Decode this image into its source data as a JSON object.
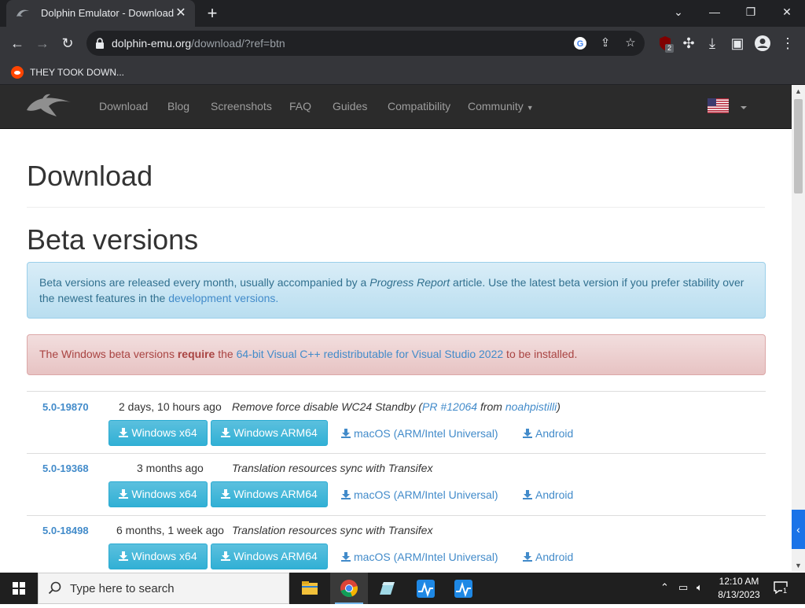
{
  "browser": {
    "tab_title": "Dolphin Emulator - Download",
    "url_host": "dolphin-emu.org",
    "url_path": "/download/?ref=btn",
    "extension_badge": "2",
    "bookmark_label": "THEY TOOK DOWN..."
  },
  "site_nav": {
    "links": [
      "Download",
      "Blog",
      "Screenshots",
      "FAQ",
      "Guides",
      "Compatibility",
      "Community"
    ]
  },
  "content": {
    "page_title": "Download",
    "section_title": "Beta versions",
    "info_text_1": "Beta versions are released every month, usually accompanied by a ",
    "info_text_em": "Progress Report",
    "info_text_2": " article. Use the latest beta version if you prefer stability over the newest features in the ",
    "info_link": "development versions.",
    "warning_text_1": "The Windows beta versions ",
    "warning_bold": "require",
    "warning_text_2": " the ",
    "warning_link": "64-bit Visual C++ redistributable for Visual Studio 2022",
    "warning_text_3": " to be installed."
  },
  "releases": [
    {
      "version": "5.0-19870",
      "age": "2 days, 10 hours ago",
      "desc_text": "Remove force disable WC24 Standby (",
      "pr_link": "PR #12064",
      "from": " from ",
      "author": "noahpistilli",
      "close": ")"
    },
    {
      "version": "5.0-19368",
      "age": "3 months ago",
      "desc_text": "Translation resources sync with Transifex"
    },
    {
      "version": "5.0-18498",
      "age": "6 months, 1 week ago",
      "desc_text": "Translation resources sync with Transifex"
    }
  ],
  "download_labels": {
    "win_x64": "Windows x64",
    "win_arm64": "Windows ARM64",
    "macos": "macOS (ARM/Intel Universal)",
    "android": "Android"
  },
  "taskbar": {
    "search_placeholder": "Type here to search",
    "time": "12:10 AM",
    "date": "8/13/2023",
    "notification_count": "1"
  },
  "colors": {
    "link": "#428bca",
    "button": "#5bc0de",
    "navbar": "#2b2b2b"
  }
}
